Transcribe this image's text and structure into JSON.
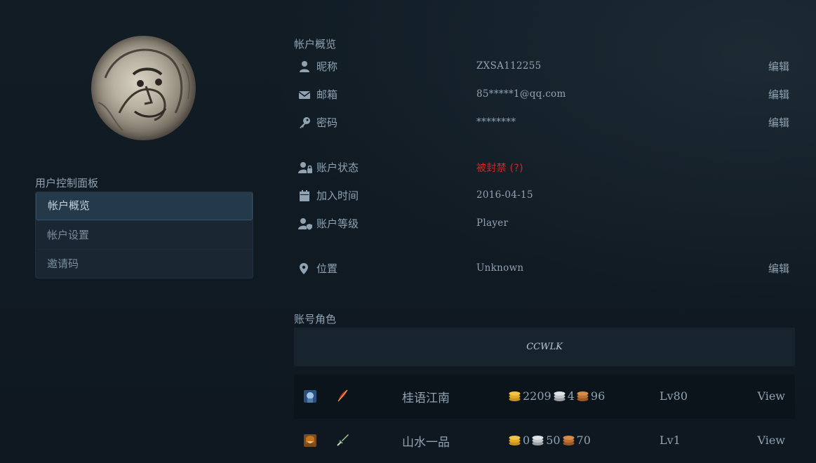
{
  "sidebar": {
    "panel_title": "用户控制面板",
    "items": [
      {
        "label": "帐户概览"
      },
      {
        "label": "帐户设置"
      },
      {
        "label": "邀请码"
      }
    ]
  },
  "overview": {
    "title": "帐户概览",
    "nickname": {
      "label": "昵称",
      "value": "ZXSA112255",
      "edit": "编辑"
    },
    "email": {
      "label": "邮箱",
      "value": "85*****1@qq.com",
      "edit": "编辑"
    },
    "password": {
      "label": "密码",
      "value": "********",
      "edit": "编辑"
    },
    "status": {
      "label": "账户状态",
      "value": "被封禁 (?)",
      "color": "#e02020"
    },
    "joined": {
      "label": "加入时间",
      "value": "2016-04-15"
    },
    "level": {
      "label": "账户等级",
      "value": "Player"
    },
    "location": {
      "label": "位置",
      "value": "Unknown",
      "edit": "编辑"
    }
  },
  "characters": {
    "title": "账号角色",
    "realm": "CCWLK",
    "list": [
      {
        "name": "桂语江南",
        "gold": "2209",
        "silver": "4",
        "copper": "96",
        "level": "Lv80",
        "view": "View",
        "race_icon": "draenei-icon",
        "class_icon": "feather-icon"
      },
      {
        "name": "山水一品",
        "gold": "0",
        "silver": "50",
        "copper": "70",
        "level": "Lv1",
        "view": "View",
        "race_icon": "human-female-icon",
        "class_icon": "sword-icon"
      }
    ]
  }
}
